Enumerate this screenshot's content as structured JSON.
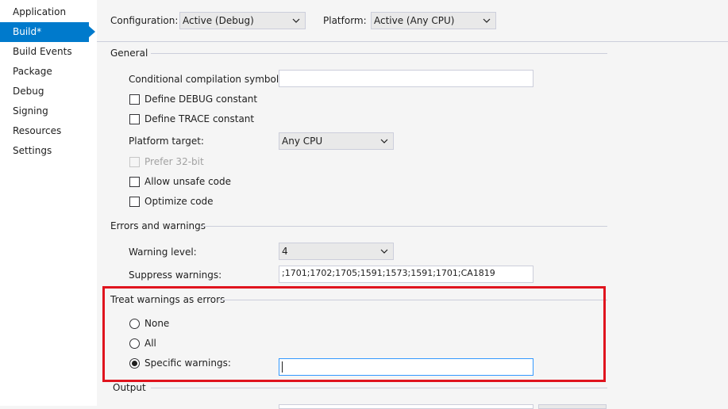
{
  "sidebar": {
    "items": [
      {
        "label": "Application",
        "active": false
      },
      {
        "label": "Build*",
        "active": true
      },
      {
        "label": "Build Events",
        "active": false
      },
      {
        "label": "Package",
        "active": false
      },
      {
        "label": "Debug",
        "active": false
      },
      {
        "label": "Signing",
        "active": false
      },
      {
        "label": "Resources",
        "active": false
      },
      {
        "label": "Settings",
        "active": false
      }
    ]
  },
  "toolbar": {
    "configuration_label": "Configuration:",
    "configuration_value": "Active (Debug)",
    "platform_label": "Platform:",
    "platform_value": "Active (Any CPU)"
  },
  "general": {
    "heading": "General",
    "conditional_symbols_label": "Conditional compilation symbols:",
    "conditional_symbols_value": "",
    "define_debug_label": "Define DEBUG constant",
    "define_debug_checked": false,
    "define_trace_label": "Define TRACE constant",
    "define_trace_checked": false,
    "platform_target_label": "Platform target:",
    "platform_target_value": "Any CPU",
    "prefer32_label": "Prefer 32-bit",
    "prefer32_enabled": false,
    "allow_unsafe_label": "Allow unsafe code",
    "allow_unsafe_checked": false,
    "optimize_label": "Optimize code",
    "optimize_checked": false
  },
  "errors_warnings": {
    "heading": "Errors and warnings",
    "warning_level_label": "Warning level:",
    "warning_level_value": "4",
    "suppress_label": "Suppress warnings:",
    "suppress_value": ";1701;1702;1705;1591;1573;1591;1701;CA1819"
  },
  "treat_warnings": {
    "heading": "Treat warnings as errors",
    "none_label": "None",
    "all_label": "All",
    "specific_label": "Specific warnings:",
    "selected": "specific",
    "specific_value": ""
  },
  "output": {
    "heading": "Output"
  },
  "colors": {
    "accent": "#007acc",
    "highlight": "#e0141e",
    "background": "#f5f5f5"
  },
  "icons": {
    "dropdown": "chevron-down-icon",
    "nav_pointer": "nav-pointer-icon"
  }
}
